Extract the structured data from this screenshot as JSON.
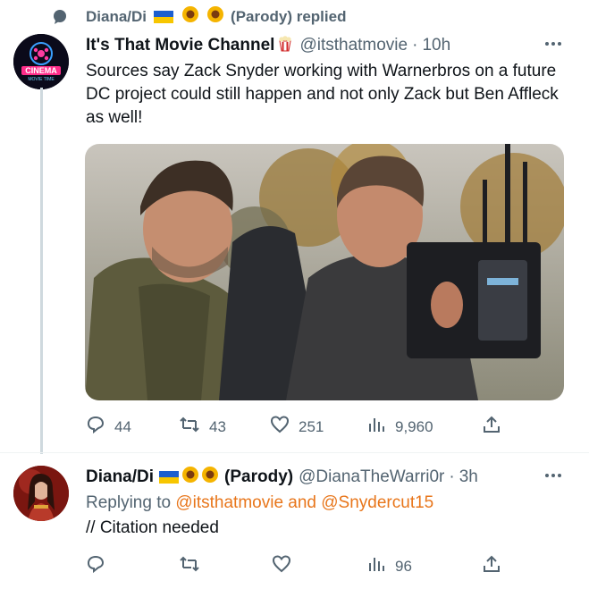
{
  "context": {
    "name": "Diana/Di",
    "suffix": "(Parody) replied"
  },
  "tweet1": {
    "display_name": "It's That Movie Channel",
    "handle": "@itsthatmovie",
    "dot": "·",
    "time": "10h",
    "avatar_sign": "CINEMA",
    "avatar_sub": "MOVIE TIME",
    "text": "Sources say Zack Snyder working with Warnerbros on a future DC project could still happen and not only Zack but Ben Affleck as well!",
    "replies": "44",
    "retweets": "43",
    "likes": "251",
    "views": "9,960"
  },
  "tweet2": {
    "display_name": "Diana/Di",
    "parody": "(Parody)",
    "handle": "@DianaTheWarri0r",
    "dot": "·",
    "time": "3h",
    "replying_prefix": "Replying to",
    "replying_links": "@itsthatmovie and @Snydercut15",
    "text": "// Citation needed",
    "views": "96"
  },
  "colors": {
    "text": "#0f1419",
    "muted": "#536471",
    "link": "#e8761b",
    "divider": "#eff3f4"
  }
}
